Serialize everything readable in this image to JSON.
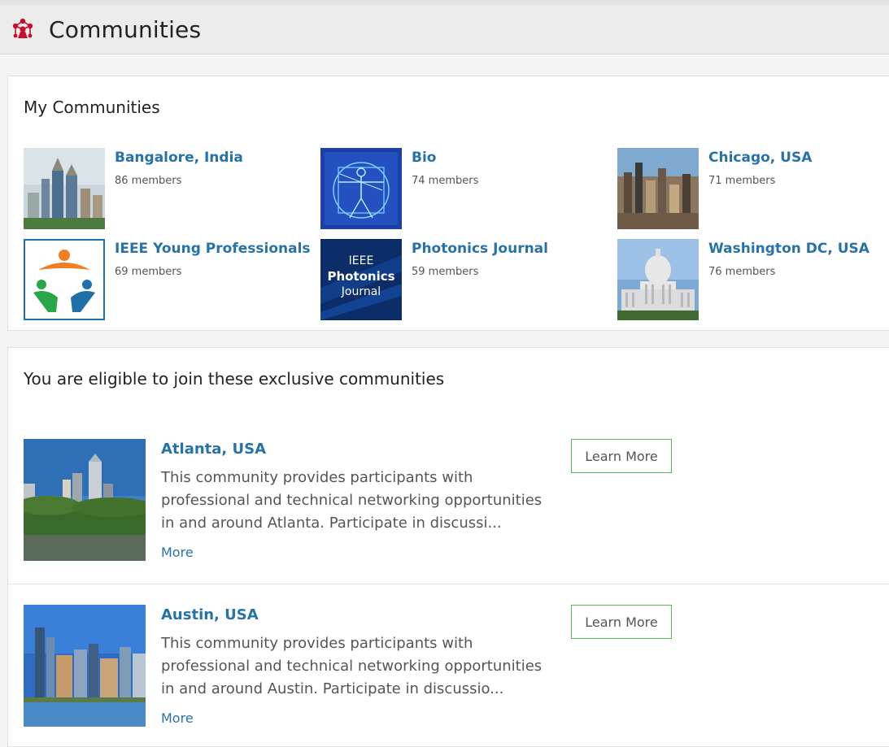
{
  "header": {
    "title": "Communities",
    "icon": "communities-network-icon",
    "icon_color": "#c8102e"
  },
  "my_communities": {
    "title": "My Communities",
    "items": [
      {
        "name": "Bangalore, India",
        "members": "86 members",
        "thumb": "bangalore-skyline-photo"
      },
      {
        "name": "Bio",
        "members": "74 members",
        "thumb": "vitruvian-man-blue-photo"
      },
      {
        "name": "Chicago, USA",
        "members": "71 members",
        "thumb": "chicago-skyline-photo"
      },
      {
        "name": "IEEE Young Professionals",
        "members": "69 members",
        "thumb": "ieee-yp-logo"
      },
      {
        "name": "Photonics Journal",
        "members": "59 members",
        "thumb": "photonics-journal-cover",
        "thumb_text": [
          "IEEE",
          "Photonics",
          "Journal"
        ]
      },
      {
        "name": "Washington DC, USA",
        "members": "76 members",
        "thumb": "capitol-building-photo"
      }
    ]
  },
  "eligible": {
    "title": "You are eligible to join these exclusive communities",
    "items": [
      {
        "name": "Atlanta, USA",
        "description": "This community provides participants with professional and technical networking opportunities in and around Atlanta. Participate in discussi...",
        "more": "More",
        "button": "Learn More",
        "photo": "atlanta-skyline-photo"
      },
      {
        "name": "Austin, USA",
        "description": "This community provides participants with professional and technical networking opportunities in and around Austin. Participate in discussio...",
        "more": "More",
        "button": "Learn More",
        "photo": "austin-skyline-photo"
      }
    ]
  },
  "colors": {
    "link": "#2872a6",
    "button_border": "#5cb85c",
    "header_bg": "#ececed"
  }
}
